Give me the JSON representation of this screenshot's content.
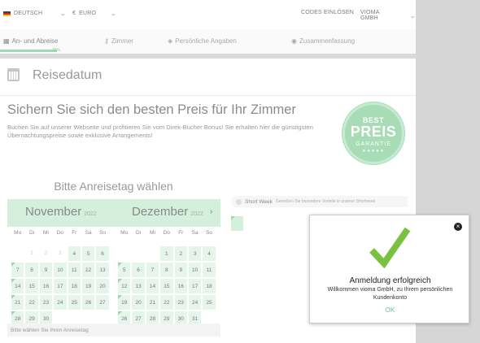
{
  "topbar": {
    "language": "DEUTSCH",
    "currency_symbol": "€",
    "currency": "EURO",
    "codes": "CODES EINLÖSEN",
    "account": "VIOMA GMBH"
  },
  "steps": [
    {
      "label": "An- und Abreise",
      "icon": "calendar-icon"
    },
    {
      "label": "Zimmer",
      "icon": "key-icon"
    },
    {
      "label": "Persönliche Angaben",
      "icon": "tag-icon"
    },
    {
      "label": "Zusammenfassung",
      "icon": "eye-icon"
    }
  ],
  "progress": {
    "label": "15%",
    "value": 0.15
  },
  "section_title": "Reisedatum",
  "headline": "Sichern Sie sich den besten Preis für Ihr Zimmer",
  "subtext": "Buchen Sie auf unserer Webseite und profitieren Sie vom Direk-Bucher Bonus! Sie erhalten hier die günstigsten Übernachtungspreise sowie exklusive Arrangements!",
  "seal": {
    "line1": "BEST",
    "line2": "PREIS",
    "line3": "GARANTIE",
    "stars": "★★★★★"
  },
  "pick_title": "Bitte Anreisetag wählen",
  "weekdays": [
    "Mo",
    "Di",
    "Mi",
    "Do",
    "Fr",
    "Sa",
    "So"
  ],
  "calendars": [
    {
      "month": "November",
      "year": "2022"
    },
    {
      "month": "Dezember",
      "year": "2022"
    }
  ],
  "calendar_footer": "Bitte wählen Sie Ihren Anreisetag",
  "short_week": {
    "label": "Short Week",
    "note": "Genießen Sie besondere Vorteile in unserer Shortweek"
  },
  "modal": {
    "title": "Anmeldung erfolgreich",
    "body": "Willkommen vioma GmbH, zu Ihrem persönlichen Kundenkonto",
    "ok": "OK",
    "close": "×"
  },
  "colors": {
    "accent": "#6cc08a",
    "calendar": "#d4f0dd",
    "check": "#7ac142"
  }
}
